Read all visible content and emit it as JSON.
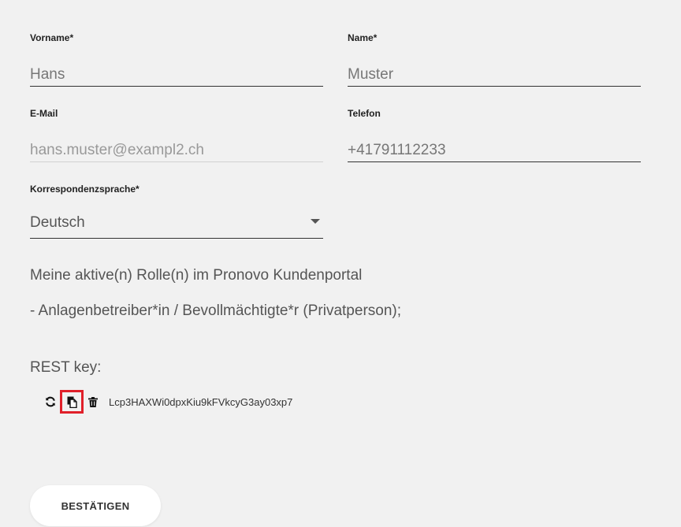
{
  "form": {
    "firstname": {
      "label": "Vorname*",
      "value": "Hans"
    },
    "lastname": {
      "label": "Name*",
      "value": "Muster"
    },
    "email": {
      "label": "E-Mail",
      "value": "hans.muster@exampl2.ch"
    },
    "phone": {
      "label": "Telefon",
      "value": "+41791112233"
    },
    "language": {
      "label": "Korrespondenzsprache*",
      "selected": "Deutsch"
    }
  },
  "roles": {
    "heading": "Meine aktive(n) Rolle(n) im Pronovo Kundenportal",
    "items": [
      "- Anlagenbetreiber*in / Bevollmächtigte*r (Privatperson);"
    ]
  },
  "rest_key": {
    "label": "REST key:",
    "value": "Lcp3HAXWi0dpxKiu9kFVkcyG3ay03xp7",
    "icons": [
      "refresh-icon",
      "copy-icon",
      "trash-icon"
    ]
  },
  "actions": {
    "confirm_label": "BESTÄTIGEN"
  },
  "colors": {
    "background": "#f1f1f1",
    "highlight": "#e0202a",
    "button_bg": "#ffffff"
  }
}
